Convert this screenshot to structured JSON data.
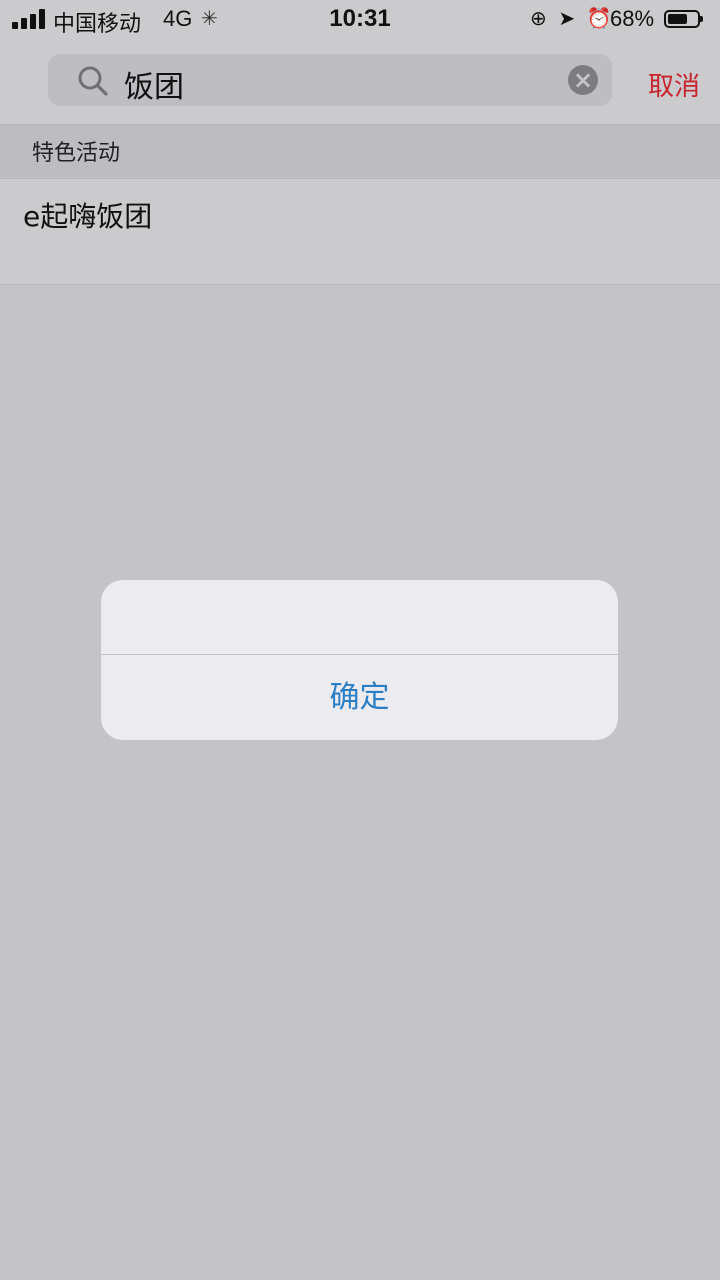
{
  "status_bar": {
    "carrier": "中国移动",
    "network": "4G",
    "time": "10:31",
    "battery_percent": "68%",
    "battery_level": 0.68
  },
  "search": {
    "query": "饭团",
    "cancel_label": "取消"
  },
  "results": {
    "section_title": "特色活动",
    "items": [
      {
        "title": "e起嗨饭团"
      }
    ]
  },
  "alert": {
    "message": "",
    "confirm_label": "确定"
  },
  "colors": {
    "cancel": "#c8242e",
    "confirm": "#2a7fc6"
  },
  "icons": {
    "search": "search-icon",
    "clear": "clear-icon",
    "signal": "signal-icon",
    "battery": "battery-icon"
  }
}
